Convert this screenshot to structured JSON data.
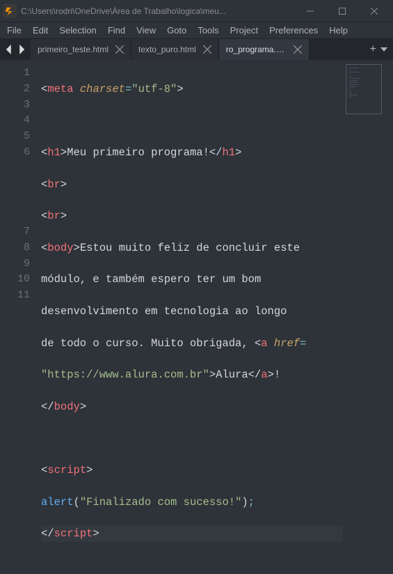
{
  "window": {
    "title": "C:\\Users\\rodri\\OneDrive\\Área de Trabalho\\logica\\meu..."
  },
  "menu": {
    "items": [
      "File",
      "Edit",
      "Selection",
      "Find",
      "View",
      "Goto",
      "Tools",
      "Project",
      "Preferences",
      "Help"
    ]
  },
  "tabs": {
    "items": [
      {
        "label": "primeiro_teste.html",
        "active": false
      },
      {
        "label": "texto_puro.html",
        "active": false
      },
      {
        "label": "ro_programa.html",
        "active": true,
        "overflow": true
      }
    ],
    "plus": "+"
  },
  "gutter": {
    "lines": [
      "1",
      "2",
      "3",
      "4",
      "5",
      "6",
      "",
      "",
      "",
      "",
      "7",
      "8",
      "9",
      "10",
      "11"
    ]
  },
  "code": {
    "l1": {
      "o": "<",
      "t": "meta",
      "sp": " ",
      "a": "charset",
      "e": "=",
      "s": "\"utf-8\"",
      "c": ">"
    },
    "l3": {
      "o": "<",
      "t": "h1",
      "c": ">",
      "txt": "Meu primeiro programa!",
      "oc": "</",
      "tc": "h1",
      "cc": ">"
    },
    "l4": {
      "o": "<",
      "t": "br",
      "c": ">"
    },
    "l5": {
      "o": "<",
      "t": "br",
      "c": ">"
    },
    "l6": {
      "o": "<",
      "t": "body",
      "c": ">",
      "txt": "Estou muito feliz de concluir este",
      "w2": "módulo, e também espero ter um bom",
      "w3": "desenvolvimento em tecnologia ao longo",
      "w4": "de todo o curso. Muito obrigada, ",
      "ao": "<",
      "at": "a",
      "asp": " ",
      "an": "href",
      "ae": "=",
      "w5": "\"https://www.alura.com.br\"",
      "w5c": ">",
      "w5t": "Alura",
      "aco": "</",
      "act": "a",
      "acc": ">",
      "ex": "!"
    },
    "l7": {
      "o": "</",
      "t": "body",
      "c": ">"
    },
    "l9": {
      "o": "<",
      "t": "script",
      "c": ">"
    },
    "l10": {
      "fn": "alert",
      "p1": "(",
      "s": "\"Finalizado com sucesso!\"",
      "p2": ")",
      "sc": ";"
    },
    "l11": {
      "o": "</",
      "t": "script",
      "c": ">"
    }
  }
}
